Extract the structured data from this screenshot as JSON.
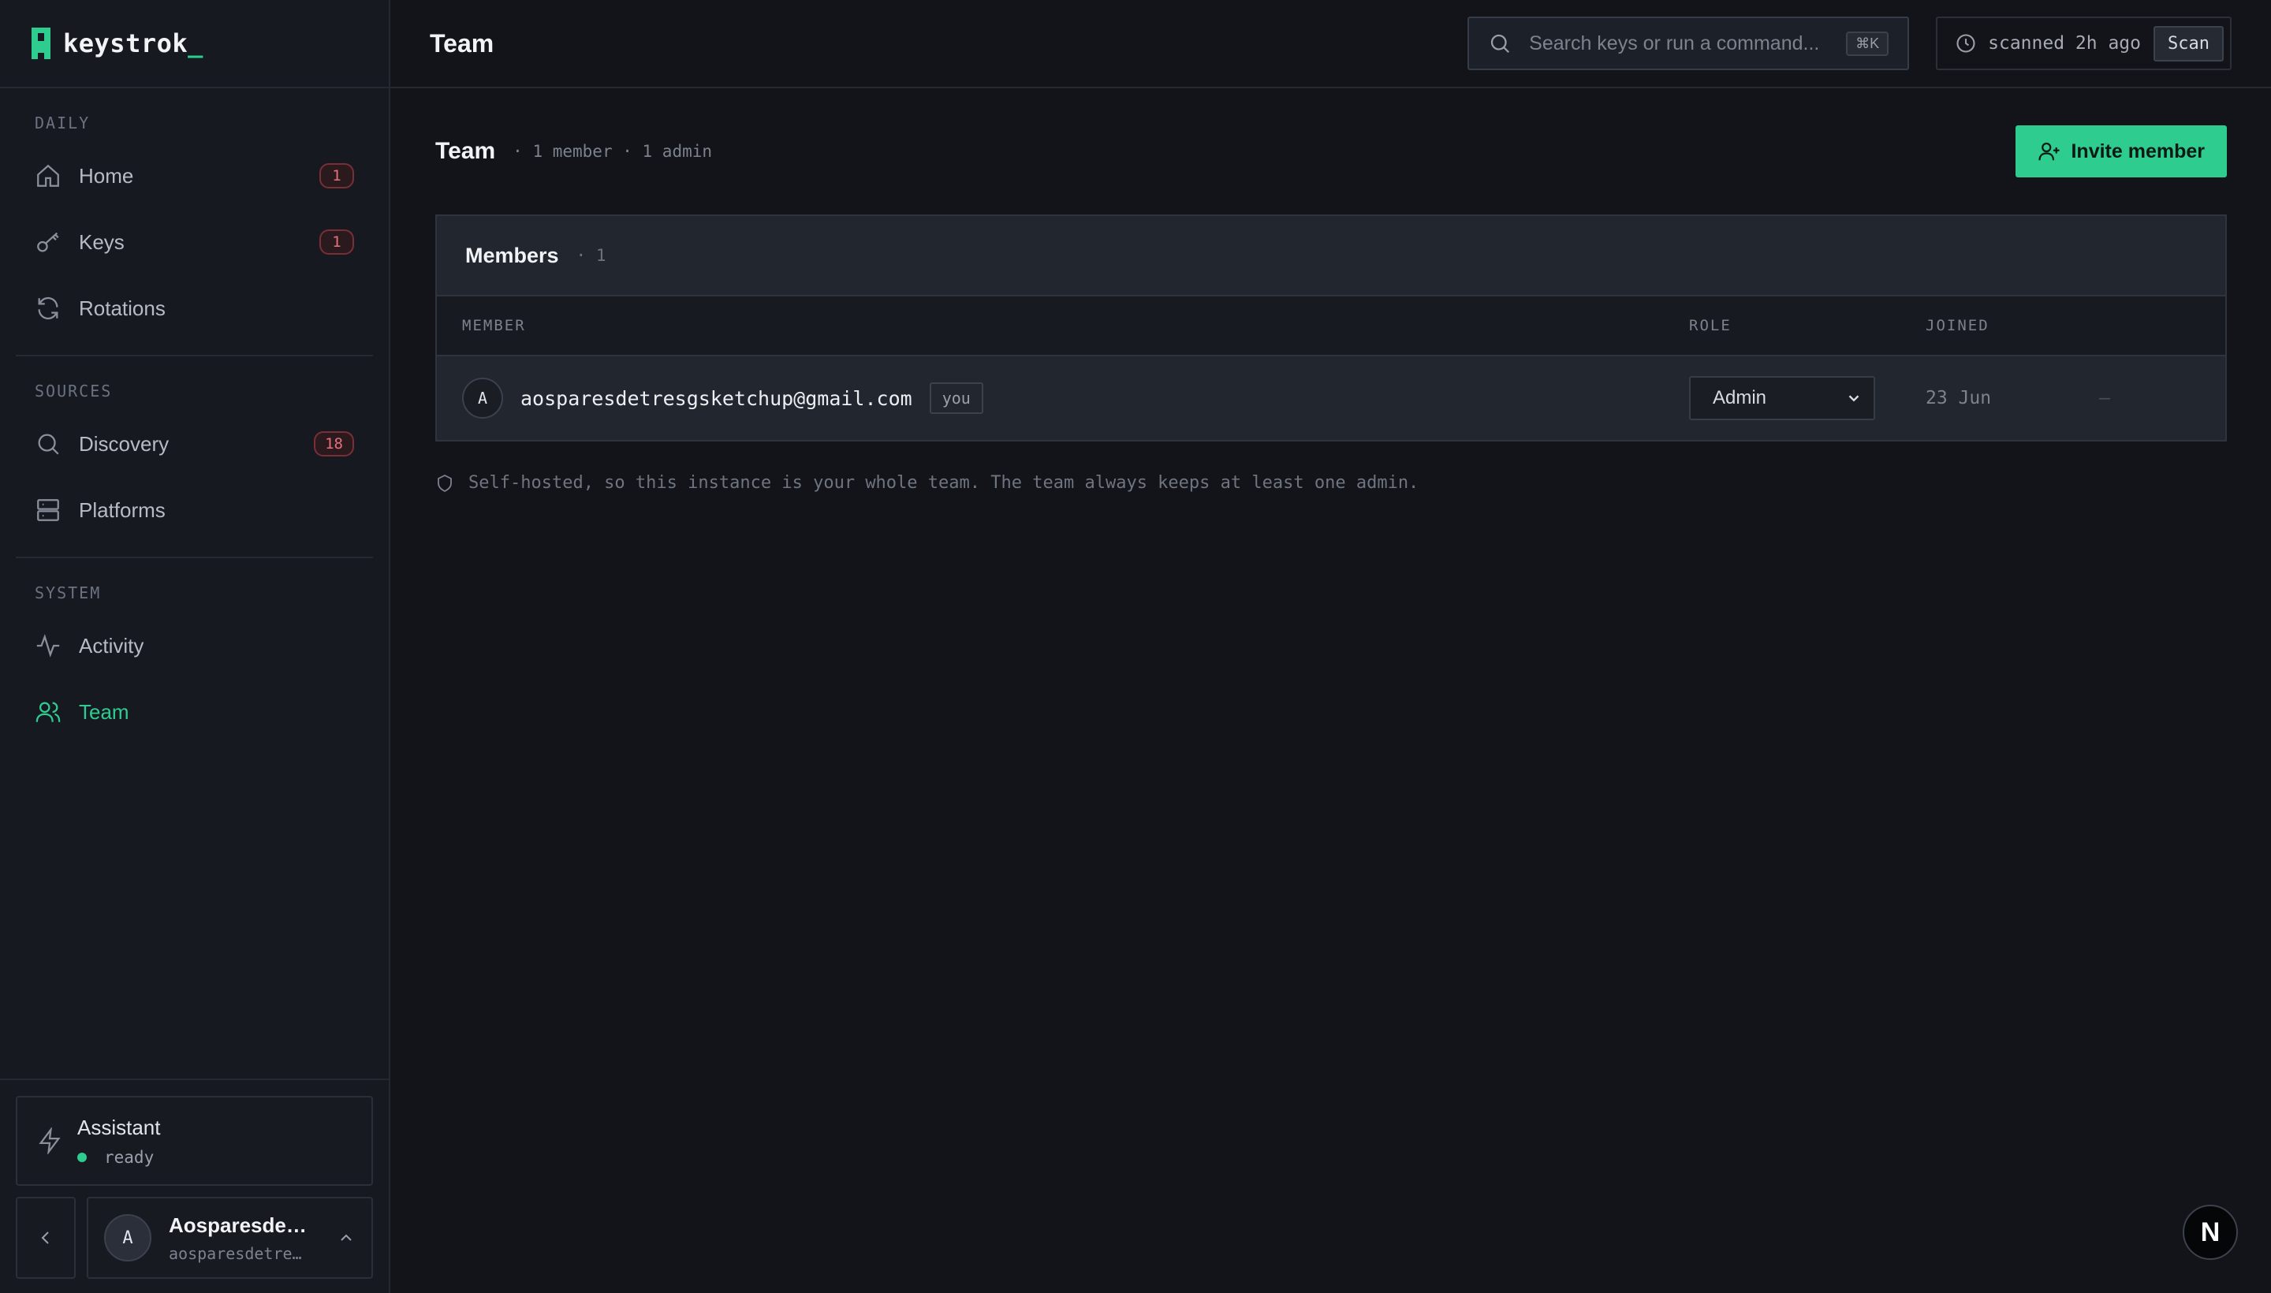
{
  "brand": {
    "name": "keystrok",
    "cursor": "_",
    "accent": "#2ecc8f"
  },
  "sidebar": {
    "sections": [
      {
        "label": "DAILY",
        "items": [
          {
            "label": "Home",
            "badge": "1",
            "icon": "home-icon"
          },
          {
            "label": "Keys",
            "badge": "1",
            "icon": "key-icon"
          },
          {
            "label": "Rotations",
            "badge": null,
            "icon": "refresh-icon"
          }
        ]
      },
      {
        "label": "SOURCES",
        "items": [
          {
            "label": "Discovery",
            "badge": "18",
            "icon": "search-icon"
          },
          {
            "label": "Platforms",
            "badge": null,
            "icon": "server-icon"
          }
        ]
      },
      {
        "label": "SYSTEM",
        "items": [
          {
            "label": "Activity",
            "badge": null,
            "icon": "activity-icon"
          },
          {
            "label": "Team",
            "badge": null,
            "icon": "users-icon",
            "active": true
          }
        ]
      }
    ],
    "assistant": {
      "title": "Assistant",
      "status": "ready"
    },
    "user": {
      "initial": "A",
      "name": "Aosparesdet…",
      "email": "aosparesdetres…"
    }
  },
  "topbar": {
    "title": "Team",
    "search": {
      "placeholder": "Search keys or run a command...",
      "shortcut": "⌘K"
    },
    "scan": {
      "status": "scanned 2h ago",
      "button": "Scan"
    }
  },
  "main": {
    "title": "Team",
    "meta": "· 1 member · 1 admin",
    "invite_button": "Invite member",
    "panel": {
      "title": "Members",
      "count": "· 1",
      "columns": [
        "MEMBER",
        "ROLE",
        "JOINED"
      ],
      "rows": [
        {
          "initial": "A",
          "email": "aosparesdetresgsketchup@gmail.com",
          "tag": "you",
          "role": "Admin",
          "joined": "23 Jun",
          "last": "—"
        }
      ]
    },
    "note": "Self-hosted, so this instance is your whole team. The team always keeps at least one admin."
  },
  "floating": {
    "label": "N"
  }
}
